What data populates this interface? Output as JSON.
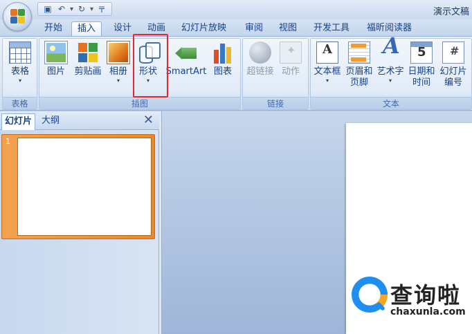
{
  "titlebar": {
    "doc_title": "演示文稿"
  },
  "qat": {
    "save_icon": "save-icon",
    "undo_icon": "undo-icon",
    "redo_icon": "redo-icon",
    "dropdown": "▾",
    "customize": "〒"
  },
  "tabs": [
    {
      "label": "开始"
    },
    {
      "label": "插入"
    },
    {
      "label": "设计"
    },
    {
      "label": "动画"
    },
    {
      "label": "幻灯片放映"
    },
    {
      "label": "审阅"
    },
    {
      "label": "视图"
    },
    {
      "label": "开发工具"
    },
    {
      "label": "福昕阅读器"
    }
  ],
  "ribbon": {
    "groups": {
      "table": "表格",
      "illustrations": "插图",
      "links": "链接",
      "text": "文本"
    },
    "buttons": {
      "table": "表格",
      "picture": "图片",
      "clipart": "剪贴画",
      "album": "相册",
      "shapes": "形状",
      "smartart": "SmartArt",
      "chart": "图表",
      "hyperlink": "超链接",
      "action": "动作",
      "textbox": "文本框",
      "header_line1": "页眉和",
      "header_line2": "页脚",
      "wordart": "艺术字",
      "date_line1": "日期和",
      "date_line2": "时间",
      "slideno_line1": "幻灯片",
      "slideno_line2": "编号"
    },
    "arrow": "▾"
  },
  "left_pane": {
    "tab_slides": "幻灯片",
    "tab_outline": "大纲",
    "close": "✕",
    "slide_number": "1"
  },
  "watermark": {
    "name": "查询啦",
    "url": "chaxunla.com"
  },
  "colors": {
    "highlight": "#e8262d",
    "accent": "#15428b",
    "thumb_border": "#e88a2c"
  }
}
